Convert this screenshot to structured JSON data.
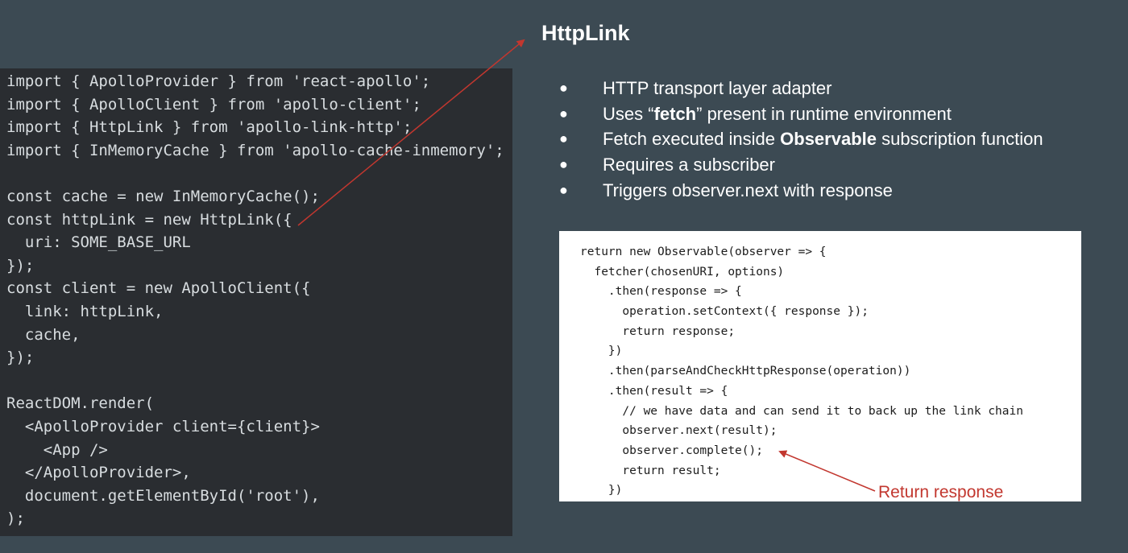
{
  "slide": {
    "title": "HttpLink",
    "bullets": [
      {
        "pre": "HTTP transport layer adapter",
        "bold": "",
        "post": ""
      },
      {
        "pre": "Uses “",
        "bold": "fetch",
        "post": "” present in runtime environment"
      },
      {
        "pre": "Fetch executed inside ",
        "bold": "Observable",
        "post": " subscription function"
      },
      {
        "pre": "Requires a subscriber",
        "bold": "",
        "post": ""
      },
      {
        "pre": "Triggers observer.next with response",
        "bold": "",
        "post": ""
      }
    ],
    "bullet_glyph": "●"
  },
  "left_code": {
    "lines": [
      "import { ApolloProvider } from 'react-apollo';",
      "import { ApolloClient } from 'apollo-client';",
      "import { HttpLink } from 'apollo-link-http';",
      "import { InMemoryCache } from 'apollo-cache-inmemory';",
      "",
      "const cache = new InMemoryCache();",
      "const httpLink = new HttpLink({",
      "  uri: SOME_BASE_URL",
      "});",
      "const client = new ApolloClient({",
      "  link: httpLink,",
      "  cache,",
      "});",
      "",
      "ReactDOM.render(",
      "  <ApolloProvider client={client}>",
      "    <App />",
      "  </ApolloProvider>,",
      "  document.getElementById('root'),",
      ");"
    ]
  },
  "right_code": {
    "lines": [
      "return new Observable(observer => {",
      "  fetcher(chosenURI, options)",
      "    .then(response => {",
      "      operation.setContext({ response });",
      "      return response;",
      "    })",
      "    .then(parseAndCheckHttpResponse(operation))",
      "    .then(result => {",
      "      // we have data and can send it to back up the link chain",
      "      observer.next(result);",
      "      observer.complete();",
      "      return result;",
      "    })"
    ]
  },
  "annotation": {
    "label": "Return response",
    "color": "#c2372f"
  },
  "colors": {
    "background": "#3c4a53",
    "left_code_bg": "#2a2d31",
    "right_code_bg": "#ffffff",
    "arrow": "#c2372f"
  }
}
